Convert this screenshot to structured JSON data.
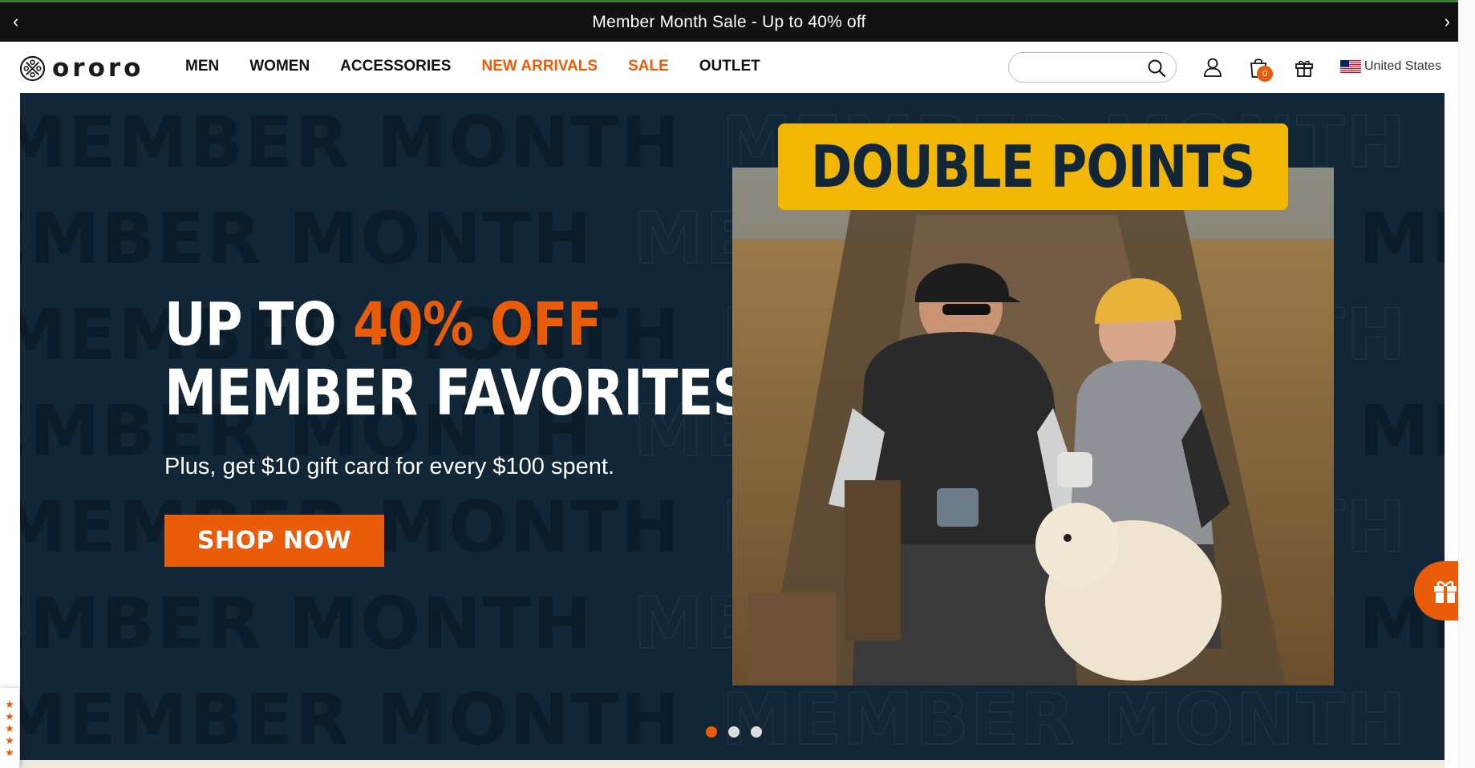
{
  "announcement": {
    "text": "Member Month Sale - Up to 40% off",
    "prev": "‹",
    "next": "›"
  },
  "header": {
    "logo_text": "ororo",
    "nav": [
      {
        "label": "MEN",
        "accent": false
      },
      {
        "label": "WOMEN",
        "accent": false
      },
      {
        "label": "ACCESSORIES",
        "accent": false
      },
      {
        "label": "NEW ARRIVALS",
        "accent": true
      },
      {
        "label": "SALE",
        "accent": true
      },
      {
        "label": "OUTLET",
        "accent": false
      }
    ],
    "search": {
      "placeholder": "",
      "value": ""
    },
    "cart_count": "0",
    "locale": "United States"
  },
  "hero": {
    "watermark": "MEMBER MONTH",
    "line1_a": "UP TO ",
    "line1_b": "40% OFF",
    "line2": "MEMBER FAVORITES",
    "subtitle": "Plus, get $10 gift card for every $100 spent.",
    "cta": "SHOP NOW",
    "badge": "DOUBLE POINTS",
    "slides": 3,
    "active_slide": 1
  },
  "colors": {
    "accent": "#e95c0a",
    "hero_bg": "#112636",
    "badge": "#f2b705",
    "announce_bg": "#121212"
  }
}
